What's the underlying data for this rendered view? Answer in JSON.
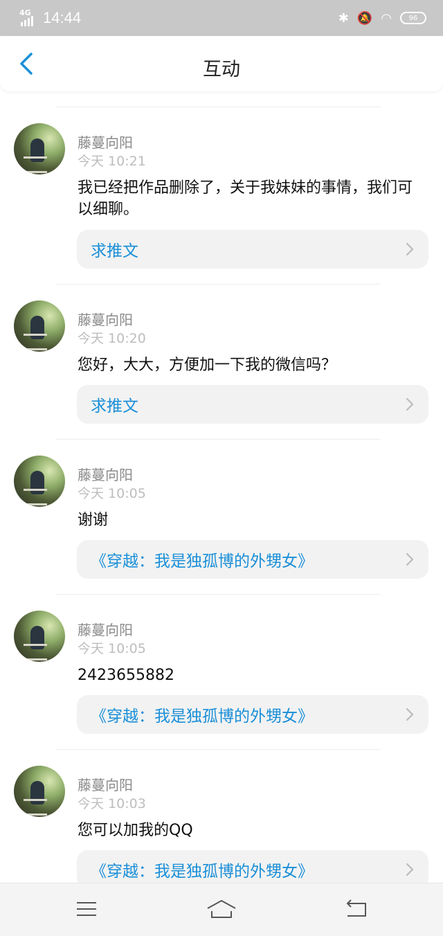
{
  "status": {
    "network": "4G",
    "time": "14:44",
    "battery": "96"
  },
  "header": {
    "title": "互动"
  },
  "colors": {
    "accent": "#1a8fd8",
    "status_bar": "#c8c8c8"
  },
  "items": [
    {
      "name": "藤蔓向阳",
      "time": "今天 10:21",
      "message": "我已经把作品删除了，关于我妹妹的事情，我们可以细聊。",
      "tag": "求推文"
    },
    {
      "name": "藤蔓向阳",
      "time": "今天 10:20",
      "message": "您好，大大，方便加一下我的微信吗？",
      "tag": "求推文"
    },
    {
      "name": "藤蔓向阳",
      "time": "今天 10:05",
      "message": "谢谢",
      "tag": "《穿越：我是独孤博的外甥女》"
    },
    {
      "name": "藤蔓向阳",
      "time": "今天 10:05",
      "message": "2423655882",
      "tag": "《穿越：我是独孤博的外甥女》"
    },
    {
      "name": "藤蔓向阳",
      "time": "今天 10:03",
      "message": "您可以加我的QQ",
      "tag": "《穿越：我是独孤博的外甥女》"
    }
  ],
  "nav": {
    "icons": [
      "menu-icon",
      "home-icon",
      "back-nav-icon"
    ]
  }
}
